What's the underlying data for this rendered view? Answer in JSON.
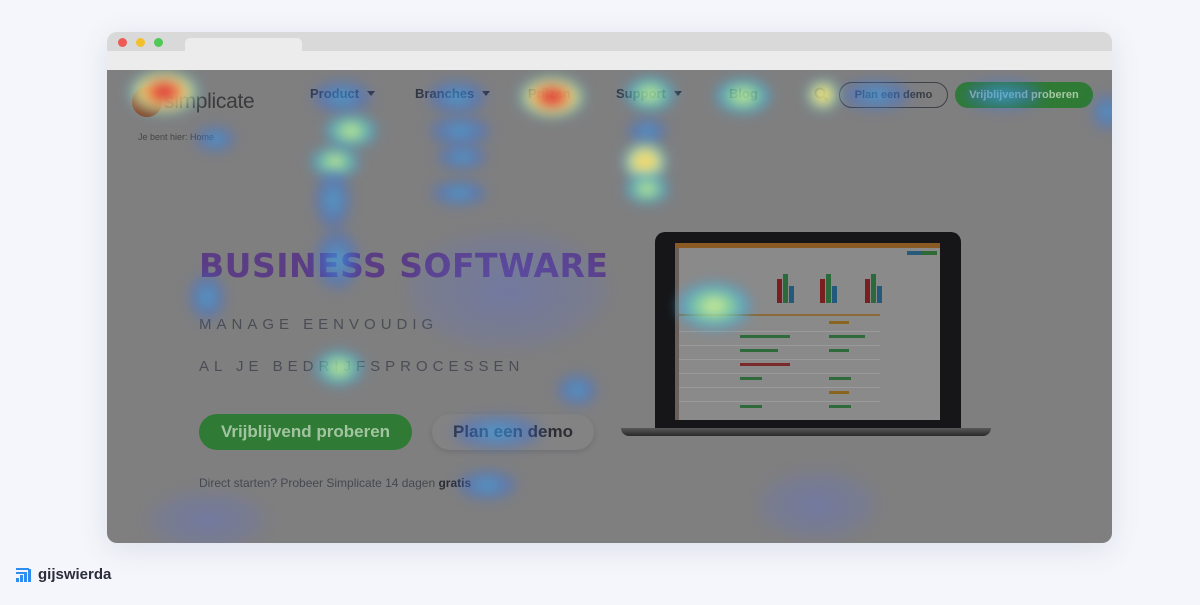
{
  "window": {
    "traffic_lights": [
      "close",
      "minimize",
      "maximize"
    ]
  },
  "site": {
    "logo_text": "simplicate",
    "nav": [
      {
        "label": "Product",
        "has_dropdown": true
      },
      {
        "label": "Branches",
        "has_dropdown": true
      },
      {
        "label": "Prijzen",
        "has_dropdown": false
      },
      {
        "label": "Support",
        "has_dropdown": true
      },
      {
        "label": "Blog",
        "has_dropdown": false
      }
    ],
    "nav_demo_button": "Plan een demo",
    "nav_trial_button": "Vrijblijvend proberen",
    "breadcrumb": "Je bent hier: Home"
  },
  "hero": {
    "title": "BUSINESS SOFTWARE",
    "subtitle_line1": "MANAGE EENVOUDIG",
    "subtitle_line2": "AL JE BEDRIJFSPROCESSEN",
    "primary_button": "Vrijblijvend proberen",
    "secondary_button": "Plan een demo",
    "trial_text": "Direct starten? Probeer Simplicate 14 dagen ",
    "trial_bold": "gratis"
  },
  "colors": {
    "heading_purple": "#5b3d86",
    "cta_green": "#2f7a34",
    "overlay_gray": "#7f7f80",
    "background": "#f4f6fb"
  },
  "footer": {
    "brand": "gijswierda"
  }
}
